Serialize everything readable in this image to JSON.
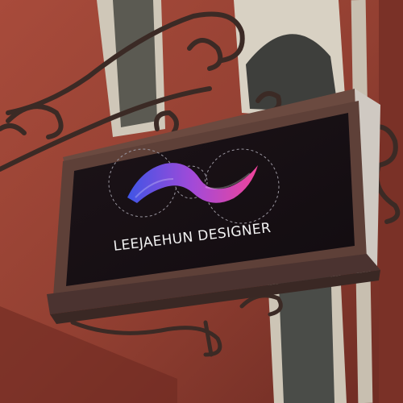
{
  "sign": {
    "text": "LEEJAEHUN DESIGNER"
  },
  "colors": {
    "wall": "#9a4436",
    "wall_dark": "#6f2a22",
    "window_frame": "#d9d3c6",
    "iron": "#3b2a25",
    "sign_frame": "#6b4a40",
    "sign_panel": "#1a1116",
    "logo_start": "#3f55e6",
    "logo_mid": "#a24ad8",
    "logo_end": "#f0449a"
  }
}
